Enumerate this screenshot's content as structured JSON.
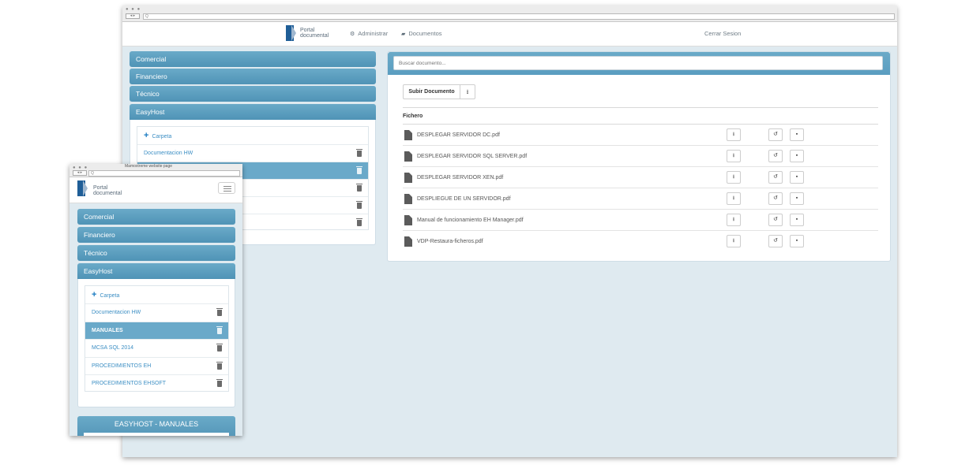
{
  "app": {
    "logo_line1": "Portal",
    "logo_line2": "documental"
  },
  "desktop": {
    "address_placeholder": "Q",
    "nav": {
      "admin_label": "Administrar",
      "docs_label": "Documentos",
      "logout_label": "Cerrar Sesion"
    },
    "categories": [
      "Comercial",
      "Financiero",
      "Técnico",
      "EasyHost"
    ],
    "folder_add_label": "Carpeta",
    "folders": [
      "Documentacion HW",
      "",
      "",
      "",
      ""
    ],
    "search_placeholder": "Buscar documento...",
    "upload_label": "Subir Documento",
    "column_header": "Fichero",
    "files": [
      "DESPLEGAR SERVIDOR DC.pdf",
      "DESPLEGAR SERVIDOR SQL SERVER.pdf",
      "DESPLEGAR SERVIDOR XEN.pdf",
      "DESPLIEGUE DE UN SERVIDOR.pdf",
      "Manual de funcionamiento EH Manager.pdf",
      "VDP-Restaura-ficheros.pdf"
    ]
  },
  "mobile": {
    "window_title": "Mamoxtreme website page",
    "address_placeholder": "Q",
    "categories": [
      "Comercial",
      "Financiero",
      "Técnico",
      "EasyHost"
    ],
    "folder_add_label": "Carpeta",
    "folders": [
      "Documentacion HW",
      "MANUALES",
      "MCSA SQL 2014",
      "PROCEDIMIENTOS EH",
      "PROCEDIMIENTOS EHSOFT"
    ],
    "selected_folder": "MANUALES",
    "panel_title": "EASYHOST - MANUALES"
  },
  "icons": {
    "admin": "gear-icon",
    "docs": "folder-icon",
    "upload": "upload-icon",
    "file": "file-icon",
    "download": "download-icon",
    "restore": "restore-icon",
    "delete": "trash-icon",
    "add": "plus-icon",
    "menu": "hamburger-icon"
  },
  "colors": {
    "accent": "#5a9dc0",
    "link": "#3d8fc4",
    "background": "#dfeaf0",
    "brand": "#1f5e97"
  }
}
